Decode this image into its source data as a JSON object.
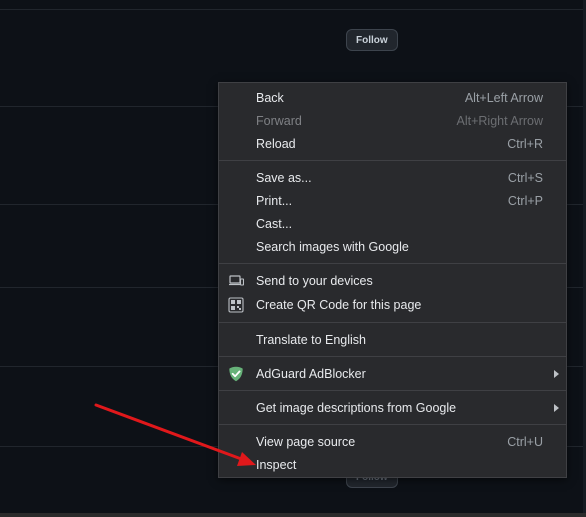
{
  "page": {
    "follow_label_top": "Follow",
    "follow_label_bottom": "Follow"
  },
  "context_menu": {
    "back": {
      "label": "Back",
      "shortcut": "Alt+Left Arrow"
    },
    "forward": {
      "label": "Forward",
      "shortcut": "Alt+Right Arrow"
    },
    "reload": {
      "label": "Reload",
      "shortcut": "Ctrl+R"
    },
    "save_as": {
      "label": "Save as...",
      "shortcut": "Ctrl+S"
    },
    "print": {
      "label": "Print...",
      "shortcut": "Ctrl+P"
    },
    "cast": {
      "label": "Cast..."
    },
    "search_images": {
      "label": "Search images with Google"
    },
    "send_to_devices": {
      "label": "Send to your devices",
      "icon": "devices-icon"
    },
    "create_qr": {
      "label": "Create QR Code for this page",
      "icon": "qr-code-icon"
    },
    "translate": {
      "label": "Translate to English"
    },
    "adguard": {
      "label": "AdGuard AdBlocker",
      "icon": "adguard-shield-icon"
    },
    "image_descriptions": {
      "label": "Get image descriptions from Google"
    },
    "view_source": {
      "label": "View page source",
      "shortcut": "Ctrl+U"
    },
    "inspect": {
      "label": "Inspect"
    }
  },
  "colors": {
    "page_background": "#0d1117",
    "menu_background": "#292a2d",
    "menu_text": "#e8eaed",
    "annotation_arrow": "#e0181b",
    "adguard_green": "#67b279"
  }
}
